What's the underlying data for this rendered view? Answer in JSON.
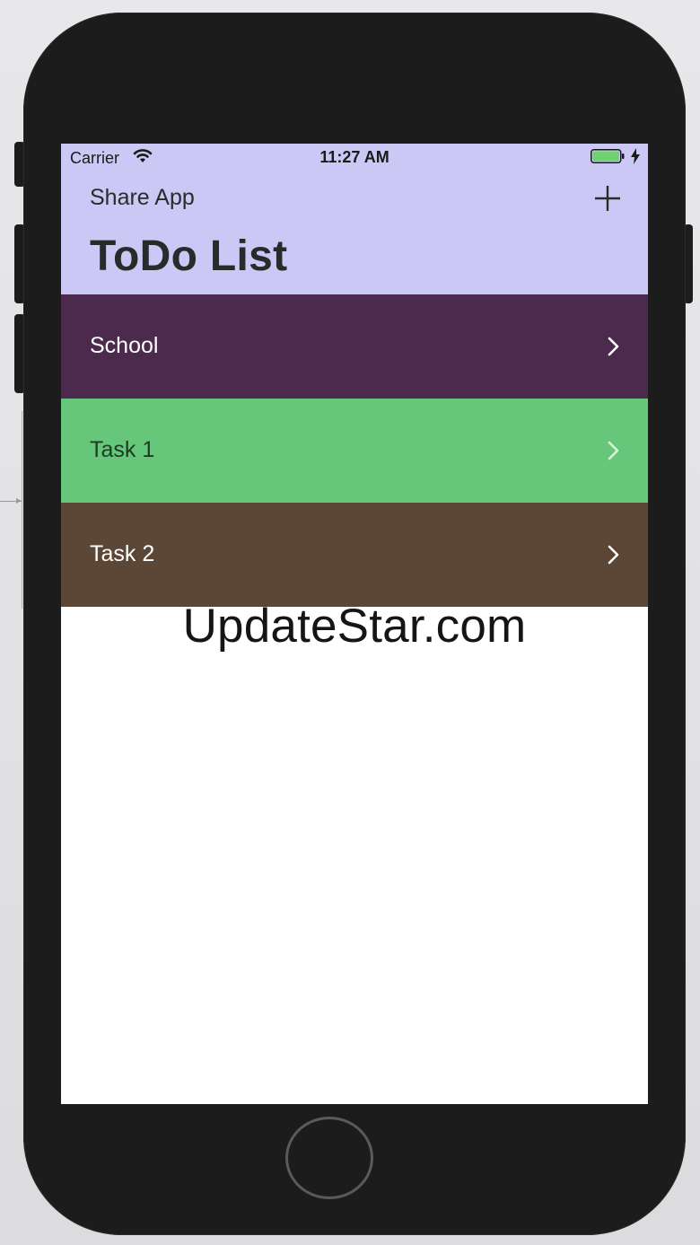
{
  "status_bar": {
    "carrier": "Carrier",
    "time": "11:27 AM",
    "battery_color": "#6ed36e"
  },
  "nav": {
    "background": "#ccc8f5",
    "share_label": "Share App",
    "add_icon": "plus-icon",
    "title": "ToDo List"
  },
  "list": {
    "items": [
      {
        "label": "School",
        "background": "#4b2a4e",
        "text_color": "#ffffff",
        "chevron_color": "#ffffff"
      },
      {
        "label": "Task 1",
        "background": "#66c77a",
        "text_color": "#1d3a23",
        "chevron_color": "#d8f2dc"
      },
      {
        "label": "Task 2",
        "background": "#5c4636",
        "text_color": "#ffffff",
        "chevron_color": "#ffffff"
      }
    ]
  },
  "watermark": "UpdateStar.com"
}
